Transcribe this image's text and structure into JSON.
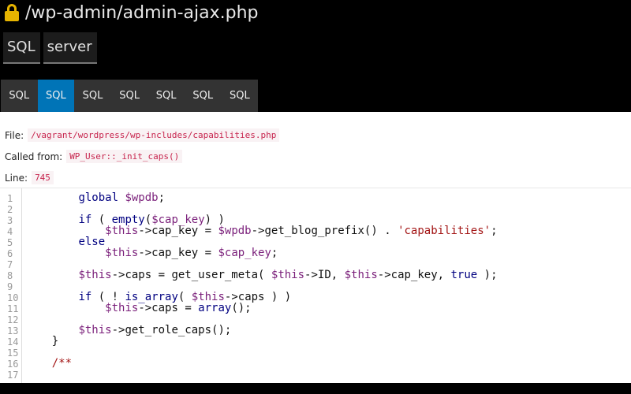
{
  "url": "/wp-admin/admin-ajax.php",
  "top_tabs": [
    "SQL",
    "server"
  ],
  "sub_tabs": [
    "SQL",
    "SQL",
    "SQL",
    "SQL",
    "SQL",
    "SQL",
    "SQL"
  ],
  "active_sub_tab": 1,
  "file_label": "File:",
  "file_value": "/vagrant/wordpress/wp-includes/capabilities.php",
  "called_label": "Called from:",
  "called_value": "WP_User::_init_caps()",
  "line_label": "Line:",
  "line_value": "745",
  "code_lines": [
    {
      "n": "1",
      "text": "        global $wpdb;"
    },
    {
      "n": "2",
      "text": ""
    },
    {
      "n": "3",
      "text": "        if ( empty($cap_key) )"
    },
    {
      "n": "4",
      "text": "            $this->cap_key = $wpdb->get_blog_prefix() . 'capabilities';"
    },
    {
      "n": "5",
      "text": "        else"
    },
    {
      "n": "6",
      "text": "            $this->cap_key = $cap_key;"
    },
    {
      "n": "7",
      "text": ""
    },
    {
      "n": "8",
      "text": "        $this->caps = get_user_meta( $this->ID, $this->cap_key, true );"
    },
    {
      "n": "9",
      "text": ""
    },
    {
      "n": "10",
      "text": "        if ( ! is_array( $this->caps ) )"
    },
    {
      "n": "11",
      "text": "            $this->caps = array();"
    },
    {
      "n": "12",
      "text": ""
    },
    {
      "n": "13",
      "text": "        $this->get_role_caps();"
    },
    {
      "n": "14",
      "text": "    }"
    },
    {
      "n": "15",
      "text": ""
    },
    {
      "n": "16",
      "text": "    /**"
    },
    {
      "n": "17",
      "text": ""
    }
  ]
}
